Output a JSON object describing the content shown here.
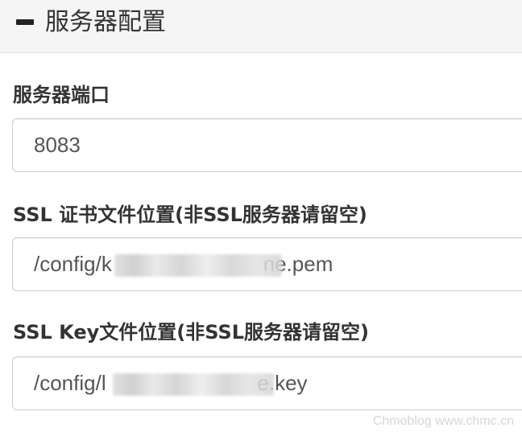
{
  "panel": {
    "title": "服务器配置",
    "collapse_icon": "minus-icon"
  },
  "fields": [
    {
      "label": "服务器端口",
      "value": "8083"
    },
    {
      "label": "SSL 证书文件位置(非SSL服务器请留空)",
      "value": "/config/k                          ne.pem"
    },
    {
      "label": "SSL Key文件位置(非SSL服务器请留空)",
      "value": "/config/l                          e.key"
    }
  ],
  "watermark": "Chmoblog www.chmc.cn"
}
